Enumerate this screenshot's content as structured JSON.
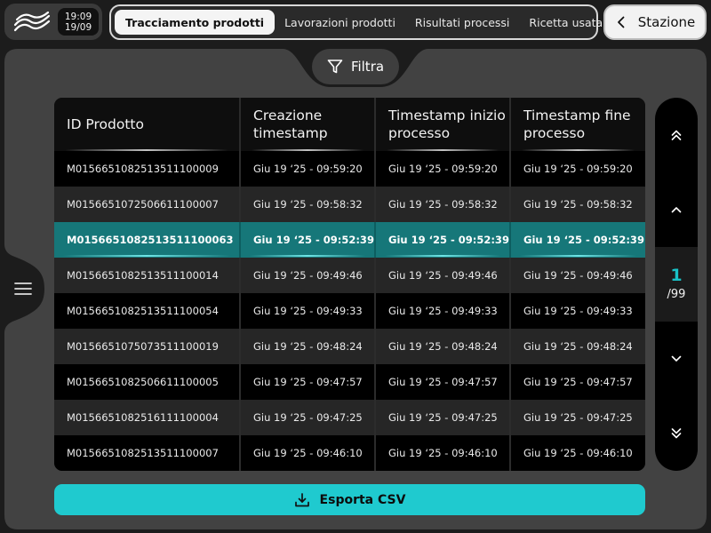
{
  "header": {
    "time": "19:09",
    "date": "19/09",
    "tabs": [
      {
        "label": "Tracciamento prodotti",
        "active": true
      },
      {
        "label": "Lavorazioni prodotti",
        "active": false
      },
      {
        "label": "Risultati processi",
        "active": false
      },
      {
        "label": "Ricetta usata",
        "active": false
      }
    ],
    "station_label": "Stazione"
  },
  "filter_label": "Filtra",
  "table": {
    "columns": [
      "ID Prodotto",
      "Creazione timestamp",
      "Timestamp inizio processo",
      "Timestamp fine processo"
    ],
    "rows": [
      [
        "M0156651082513511100009",
        "Giu 19 ‘25 - 09:59:20",
        "Giu 19 ‘25 - 09:59:20",
        "Giu 19 ‘25 - 09:59:20"
      ],
      [
        "M0156651072506611100007",
        "Giu 19 ‘25 - 09:58:32",
        "Giu 19 ‘25 - 09:58:32",
        "Giu 19 ‘25 - 09:58:32"
      ],
      [
        "M0156651082513511100063",
        "Giu 19 ‘25 - 09:52:39",
        "Giu 19 ‘25 - 09:52:39",
        "Giu 19 ‘25 - 09:52:39"
      ],
      [
        "M0156651082513511100014",
        "Giu 19 ‘25 - 09:49:46",
        "Giu 19 ‘25 - 09:49:46",
        "Giu 19 ‘25 - 09:49:46"
      ],
      [
        "M0156651082513511100054",
        "Giu 19 ‘25 - 09:49:33",
        "Giu 19 ‘25 - 09:49:33",
        "Giu 19 ‘25 - 09:49:33"
      ],
      [
        "M0156651075073511100019",
        "Giu 19 ‘25 - 09:48:24",
        "Giu 19 ‘25 - 09:48:24",
        "Giu 19 ‘25 - 09:48:24"
      ],
      [
        "M0156651082506611100005",
        "Giu 19 ‘25 - 09:47:57",
        "Giu 19 ‘25 - 09:47:57",
        "Giu 19 ‘25 - 09:47:57"
      ],
      [
        "M0156651082516111100004",
        "Giu 19 ‘25 - 09:47:25",
        "Giu 19 ‘25 - 09:47:25",
        "Giu 19 ‘25 - 09:47:25"
      ],
      [
        "M0156651082513511100007",
        "Giu 19 ‘25 - 09:46:10",
        "Giu 19 ‘25 - 09:46:10",
        "Giu 19 ‘25 - 09:46:10"
      ]
    ],
    "selected_row": 2
  },
  "pagination": {
    "current": "1",
    "total": "/99"
  },
  "export_label": "Esporta CSV",
  "colors": {
    "accent": "#1fcacf",
    "selected_row": "#167779",
    "background": "#1c1c1c",
    "panel": "#424242"
  },
  "icons": {
    "logo": "waves-logo-icon",
    "back": "chevron-left-icon",
    "filter": "funnel-icon",
    "menu": "hamburger-menu-icon",
    "first": "double-chevron-up-icon",
    "prev": "chevron-up-icon",
    "next": "chevron-down-icon",
    "last": "double-chevron-down-icon",
    "export": "download-icon"
  }
}
